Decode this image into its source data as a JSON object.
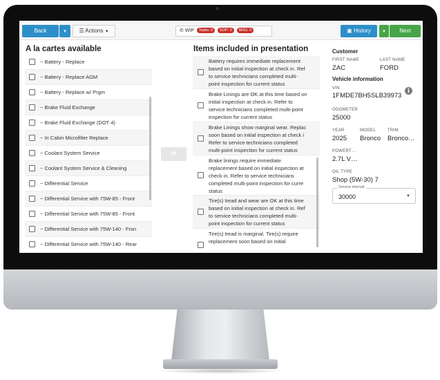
{
  "toolbar": {
    "back_label": "Back",
    "actions_label": "Actions",
    "wip_label": "WIP",
    "badges": [
      "Tasks: 0",
      "SOP: 0",
      "MSG: 0"
    ],
    "history_label": "History",
    "next_label": "Next"
  },
  "alacarte": {
    "title": "A la cartes available",
    "items": [
      "~ Battery - Replace",
      "~ Battery - Replace AGM",
      "~ Battery - Replace w/ Prgm",
      "~ Brake Fluid Exchange",
      "~ Brake Fluid Exchange (DOT 4)",
      "~ In Cabin Microfilter Replace",
      "~ Coolant System Service",
      "~ Coolant System Service & Cleaning",
      "~ Differential Service",
      "~ Differential Service with 75W-85 - Front",
      "~ Differential Service with 75W-85 - Front",
      "~ Differential Service with 75W-140 - Fron",
      "~ Differential Service with 75W-140 - Rear"
    ]
  },
  "presentation": {
    "title": "Items included in presentation",
    "items": [
      [
        "Battery requires immediate replacement",
        "based on initial inspection at check in. Ref",
        "to service technicians completed multi-",
        "point inspection for current status"
      ],
      [
        "Brake Linings are OK at this time based on",
        "initial inspection at check in. Refer to",
        "service technicians completed multi-point",
        "inspection for current status"
      ],
      [
        "Brake Linings show marginal wear. Replac",
        "soon based on initial inspection at check i",
        "Refer to service technicians completed",
        "multi-point inspection for current status"
      ],
      [
        "Brake linings require immediate",
        "replacement based on initial inspection at",
        "check in. Refer to service technicians",
        "completed multi-point inspection for curre",
        "status"
      ],
      [
        "Tire(s) tread and wear are OK at this time",
        "based on initial inspection at check in. Ref",
        "to service technicians completed multi-",
        "point inspection for current status"
      ],
      [
        "Tire(s) tread is marginal. Tire(s) require",
        "replacement soon based on initial"
      ]
    ]
  },
  "customer": {
    "heading": "Customer",
    "first_name_label": "FIRST NAME",
    "first_name": "ZAC",
    "last_name_label": "LAST NAME",
    "last_name": "FORD",
    "vehicle_heading": "Vehicle information",
    "vin_label": "VIN",
    "vin": "1FMDE7BH5SLB39973",
    "odometer_label": "ODOMETER",
    "odometer": "25000",
    "year_label": "YEAR",
    "year": "2025",
    "model_label": "MODEL",
    "model": "Bronco",
    "trim_label": "TRIM",
    "trim": "Bronco…",
    "powertrain_label": "POWERT…",
    "powertrain": "2.7L V…",
    "oil_label": "OIL TYPE",
    "oil": "Shop (5W-30) 7",
    "service_interval_label": "Service interval",
    "service_interval": "30000"
  },
  "colors": {
    "primary": "#2d8fc9",
    "success": "#47a447",
    "danger": "#c9302c"
  },
  "icons": {
    "phone": "phone-icon",
    "history": "history-icon",
    "transfer": "transfer-arrows-icon",
    "info": "info-icon"
  }
}
